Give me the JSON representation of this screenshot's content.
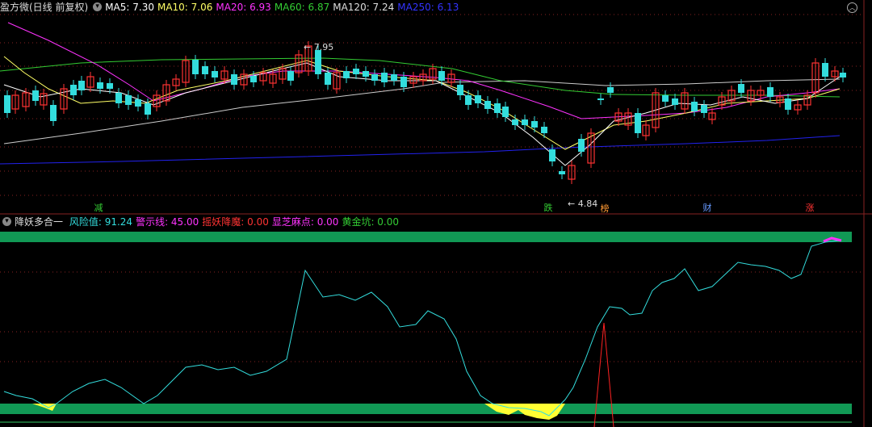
{
  "main_header": {
    "title": "盈方微(日线 前复权)",
    "ma": [
      {
        "label": "MA5:",
        "value": "7.30",
        "color": "#ffffff"
      },
      {
        "label": "MA10:",
        "value": "7.06",
        "color": "#ffff66"
      },
      {
        "label": "MA20:",
        "value": "6.93",
        "color": "#ff33ff"
      },
      {
        "label": "MA60:",
        "value": "6.87",
        "color": "#33cc33"
      },
      {
        "label": "MA120:",
        "value": "7.24",
        "color": "#dddddd"
      },
      {
        "label": "MA250:",
        "value": "6.13",
        "color": "#3333ff"
      }
    ]
  },
  "price_annotations": {
    "high": "7.95",
    "low": "4.84"
  },
  "signal_tags": [
    {
      "text": "减",
      "color": "#33cc33"
    },
    {
      "text": "跌",
      "color": "#33cc33"
    },
    {
      "text": "榜",
      "color": "#ff9933"
    },
    {
      "text": "财",
      "color": "#6699ff"
    },
    {
      "text": "涨",
      "color": "#ff3333"
    }
  ],
  "indicator_header": {
    "title": "降妖多合一",
    "fields": [
      {
        "label": "风险值:",
        "value": "91.24",
        "color": "#33dddd"
      },
      {
        "label": "警示线:",
        "value": "45.00",
        "color": "#ff33ff"
      },
      {
        "label": "摇妖降魔:",
        "value": "0.00",
        "color": "#ff3333"
      },
      {
        "label": "显芝麻点:",
        "value": "0.00",
        "color": "#ff33ff"
      },
      {
        "label": "黄金坑:",
        "value": "0.00",
        "color": "#33cc33"
      }
    ]
  },
  "colors": {
    "up": "#ff3333",
    "down": "#33dddd",
    "band": "#119955",
    "risk_line": "#33dddd",
    "dot_grid": "#882222"
  }
}
